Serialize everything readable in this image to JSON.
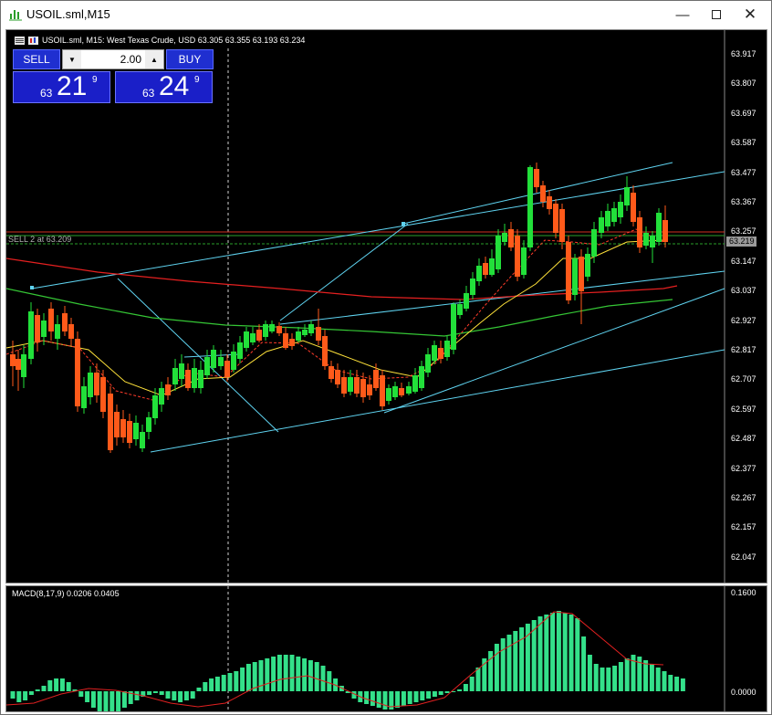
{
  "window": {
    "title": "USOIL.sml,M15"
  },
  "chart_header": {
    "text": "USOIL.sml, M15:  West Texas Crude, USD  63.305 63.355 63.193 63.234"
  },
  "trade_panel": {
    "sell_label": "SELL",
    "buy_label": "BUY",
    "lot_value": "2.00",
    "sell_price": {
      "small": "63",
      "big": "21",
      "sup": "9"
    },
    "buy_price": {
      "small": "63",
      "big": "24",
      "sup": "9"
    }
  },
  "sell_line_label": "SELL 2 at 63.209",
  "current_price_tag": "63.219",
  "price_axis": [
    "63.917",
    "63.807",
    "63.697",
    "63.587",
    "63.477",
    "63.367",
    "63.257",
    "63.147",
    "63.037",
    "62.927",
    "62.817",
    "62.707",
    "62.597",
    "62.487",
    "62.377",
    "62.267",
    "62.157",
    "62.047"
  ],
  "macd": {
    "label": "MACD(8,17,9) 0.0206 0.0405",
    "axis_top": "0.1600",
    "axis_zero": "0.0000"
  },
  "colors": {
    "bull": "#22e03a",
    "bear": "#ff5a1a",
    "channel": "#5fd3f0",
    "ma_red": "#e52020",
    "ma_green": "#35c635",
    "ma_yellow": "#ffe23a",
    "macd_hist": "#34e08a",
    "macd_signal": "#e02020"
  }
}
